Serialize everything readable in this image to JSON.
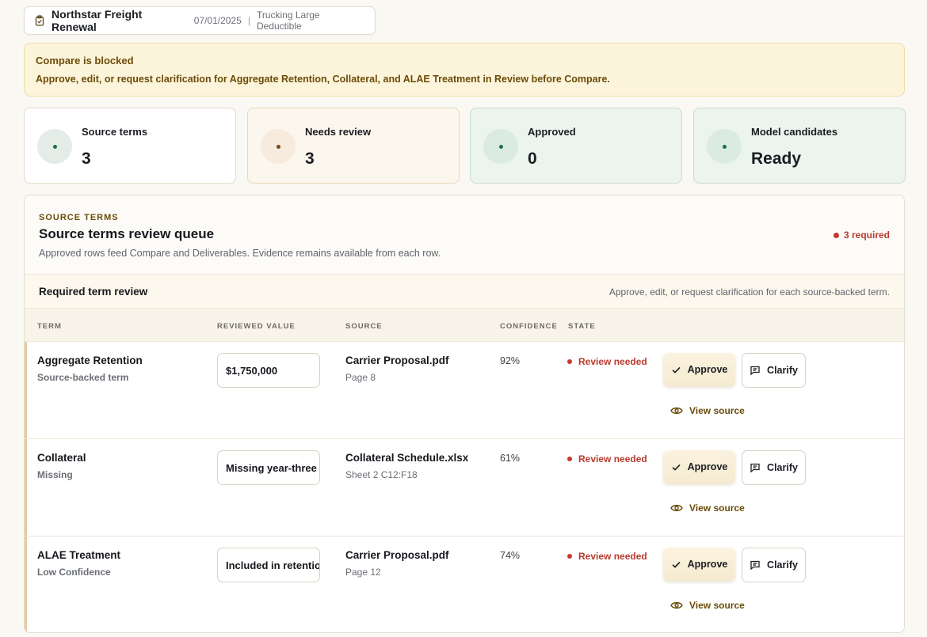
{
  "header": {
    "title": "Northstar Freight Renewal",
    "date": "07/01/2025",
    "separator": "|",
    "program": "Trucking Large Deductible"
  },
  "alert": {
    "title": "Compare is blocked",
    "body": "Approve, edit, or request clarification for Aggregate Retention, Collateral, and ALAE Treatment in Review before Compare."
  },
  "stats": [
    {
      "label": "Source terms",
      "value": "3"
    },
    {
      "label": "Needs review",
      "value": "3"
    },
    {
      "label": "Approved",
      "value": "0"
    },
    {
      "label": "Model candidates",
      "value": "Ready"
    }
  ],
  "panel": {
    "eyebrow": "SOURCE TERMS",
    "title": "Source terms review queue",
    "description": "Approved rows feed Compare and Deliverables. Evidence remains available from each row.",
    "required_badge": "3 required",
    "subheader_title": "Required term review",
    "subheader_hint": "Approve, edit, or request clarification for each source-backed term.",
    "columns": {
      "term": "TERM",
      "value": "REVIEWED VALUE",
      "source": "SOURCE",
      "confidence": "CONFIDENCE",
      "state": "STATE"
    },
    "rows": [
      {
        "term": "Aggregate Retention",
        "sub": "Source-backed term",
        "value": "$1,750,000",
        "source": "Carrier Proposal.pdf",
        "source_loc": "Page 8",
        "confidence": "92%",
        "state": "Review needed"
      },
      {
        "term": "Collateral",
        "sub": "Missing",
        "value": "Missing year-three",
        "source": "Collateral Schedule.xlsx",
        "source_loc": "Sheet 2 C12:F18",
        "confidence": "61%",
        "state": "Review needed"
      },
      {
        "term": "ALAE Treatment",
        "sub": "Low Confidence",
        "value": "Included in retention",
        "source": "Carrier Proposal.pdf",
        "source_loc": "Page 12",
        "confidence": "74%",
        "state": "Review needed"
      }
    ],
    "actions": {
      "approve": "Approve",
      "clarify": "Clarify",
      "view_source": "View source"
    }
  },
  "colors": {
    "accent_brown": "#6b4c08",
    "alert_bg": "#fdf4dc",
    "danger": "#c8382c",
    "success": "#1f6e52"
  }
}
